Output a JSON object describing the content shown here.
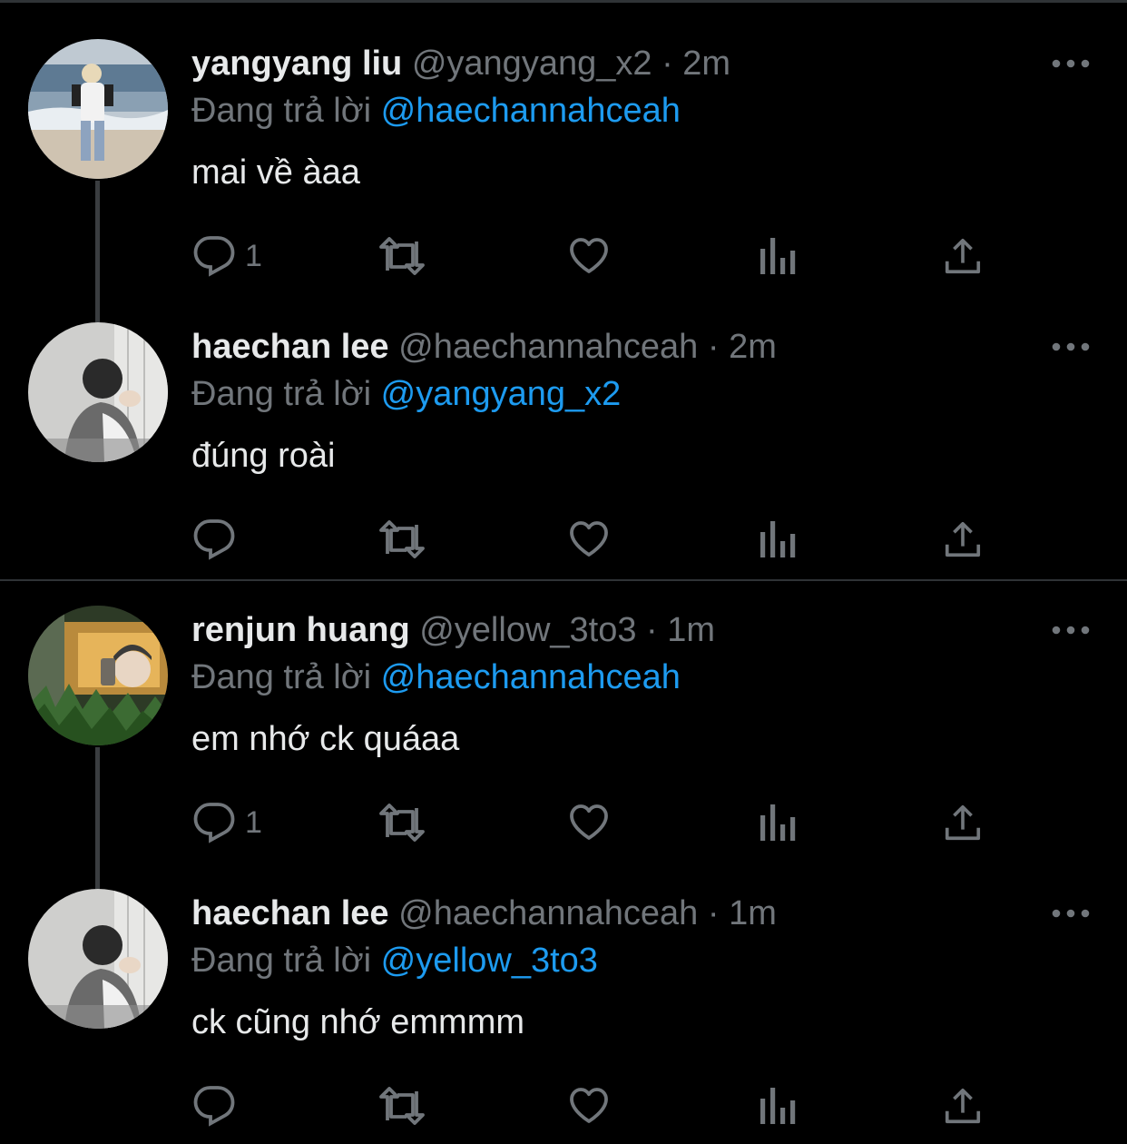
{
  "tweets": [
    {
      "name": "yangyang liu",
      "handle": "@yangyang_x2",
      "dot": "·",
      "time": "2m",
      "replying_prefix": "Đang trả lời",
      "replying_to": "@haechannahceah",
      "text": "mai về àaa",
      "reply_count": "1",
      "avatar": "avatar-beach"
    },
    {
      "name": "haechan lee",
      "handle": "@haechannahceah",
      "dot": "·",
      "time": "2m",
      "replying_prefix": "Đang trả lời",
      "replying_to": "@yangyang_x2",
      "text": "đúng roài",
      "reply_count": "",
      "avatar": "avatar-window"
    },
    {
      "name": "renjun huang",
      "handle": "@yellow_3to3",
      "dot": "·",
      "time": "1m",
      "replying_prefix": "Đang trả lời",
      "replying_to": "@haechannahceah",
      "text": "em nhớ ck quáaa",
      "reply_count": "1",
      "avatar": "avatar-mirror"
    },
    {
      "name": "haechan lee",
      "handle": "@haechannahceah",
      "dot": "·",
      "time": "1m",
      "replying_prefix": "Đang trả lời",
      "replying_to": "@yellow_3to3",
      "text": "ck cũng nhớ emmmm",
      "reply_count": "",
      "avatar": "avatar-window"
    }
  ],
  "icons": {
    "reply": "reply-icon",
    "retweet": "retweet-icon",
    "like": "heart-icon",
    "views": "views-icon",
    "share": "share-icon",
    "more": "more-icon"
  },
  "colors": {
    "background": "#000000",
    "text": "#e7e9ea",
    "muted": "#71767b",
    "mention": "#1d9bf0",
    "divider": "#2f3336"
  }
}
